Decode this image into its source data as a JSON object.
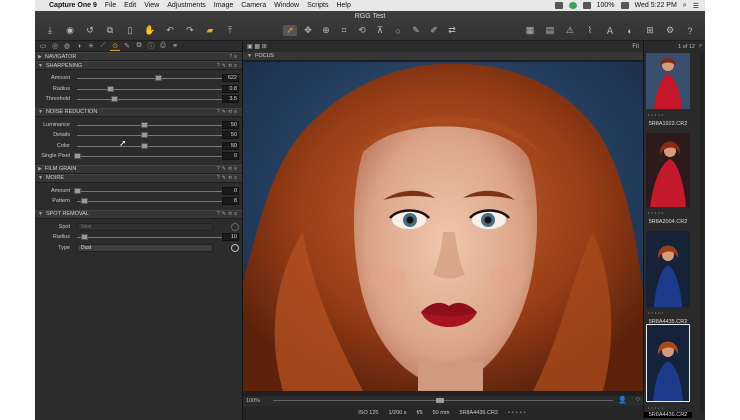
{
  "menubar": {
    "app_name": "Capture One 9",
    "items": [
      "File",
      "Edit",
      "View",
      "Adjustments",
      "Image",
      "Camera",
      "Window",
      "Scripts",
      "Help"
    ],
    "battery": "100%",
    "clock": "Wed 5:22 PM"
  },
  "window": {
    "title": "RGG Test"
  },
  "left_panel": {
    "sections": {
      "navigator": "NAVIGATOR",
      "sharpening": "SHARPENING",
      "noise_reduction": "NOISE REDUCTION",
      "film_grain": "FILM GRAIN",
      "moire": "MOIRE",
      "spot_removal": "SPOT REMOVAL"
    },
    "sharpening": {
      "amount": {
        "label": "Amount",
        "value": "622",
        "fraction": 0.55
      },
      "radius": {
        "label": "Radius",
        "value": "0.8",
        "fraction": 0.22
      },
      "threshold": {
        "label": "Threshold",
        "value": "3.5",
        "fraction": 0.25
      }
    },
    "noise_reduction": {
      "luminance": {
        "label": "Luminance",
        "value": "50",
        "fraction": 0.45
      },
      "details": {
        "label": "Details",
        "value": "50",
        "fraction": 0.45
      },
      "color": {
        "label": "Color",
        "value": "50",
        "fraction": 0.45
      },
      "single_pixel": {
        "label": "Single Pixel",
        "value": "0",
        "fraction": 0.0
      }
    },
    "moire": {
      "amount": {
        "label": "Amount",
        "value": "0",
        "fraction": 0.0
      },
      "pattern": {
        "label": "Pattern",
        "value": "8",
        "fraction": 0.05
      }
    },
    "spot_removal": {
      "spot": {
        "label": "Spot",
        "value": "Next"
      },
      "radius": {
        "label": "Radius",
        "value": "10",
        "fraction": 0.05
      },
      "type": {
        "label": "Type",
        "value": "Dust"
      }
    }
  },
  "viewer": {
    "fit_label": "Fit",
    "focus_label": "FOCUS",
    "zoom": "100%",
    "meta": {
      "iso": "ISO 125",
      "shutter": "1/200 s",
      "aperture": "f/5",
      "focal": "50 mm",
      "filename": "5R8A4436.CR2"
    }
  },
  "browser": {
    "counter": "1 of 12",
    "thumbs": [
      {
        "caption": "5R8A1922.CR2"
      },
      {
        "caption": "5R8A2004.CR2"
      },
      {
        "caption": "5R8A4435.CR2"
      },
      {
        "caption": "5R8A4436.CR2"
      }
    ]
  }
}
